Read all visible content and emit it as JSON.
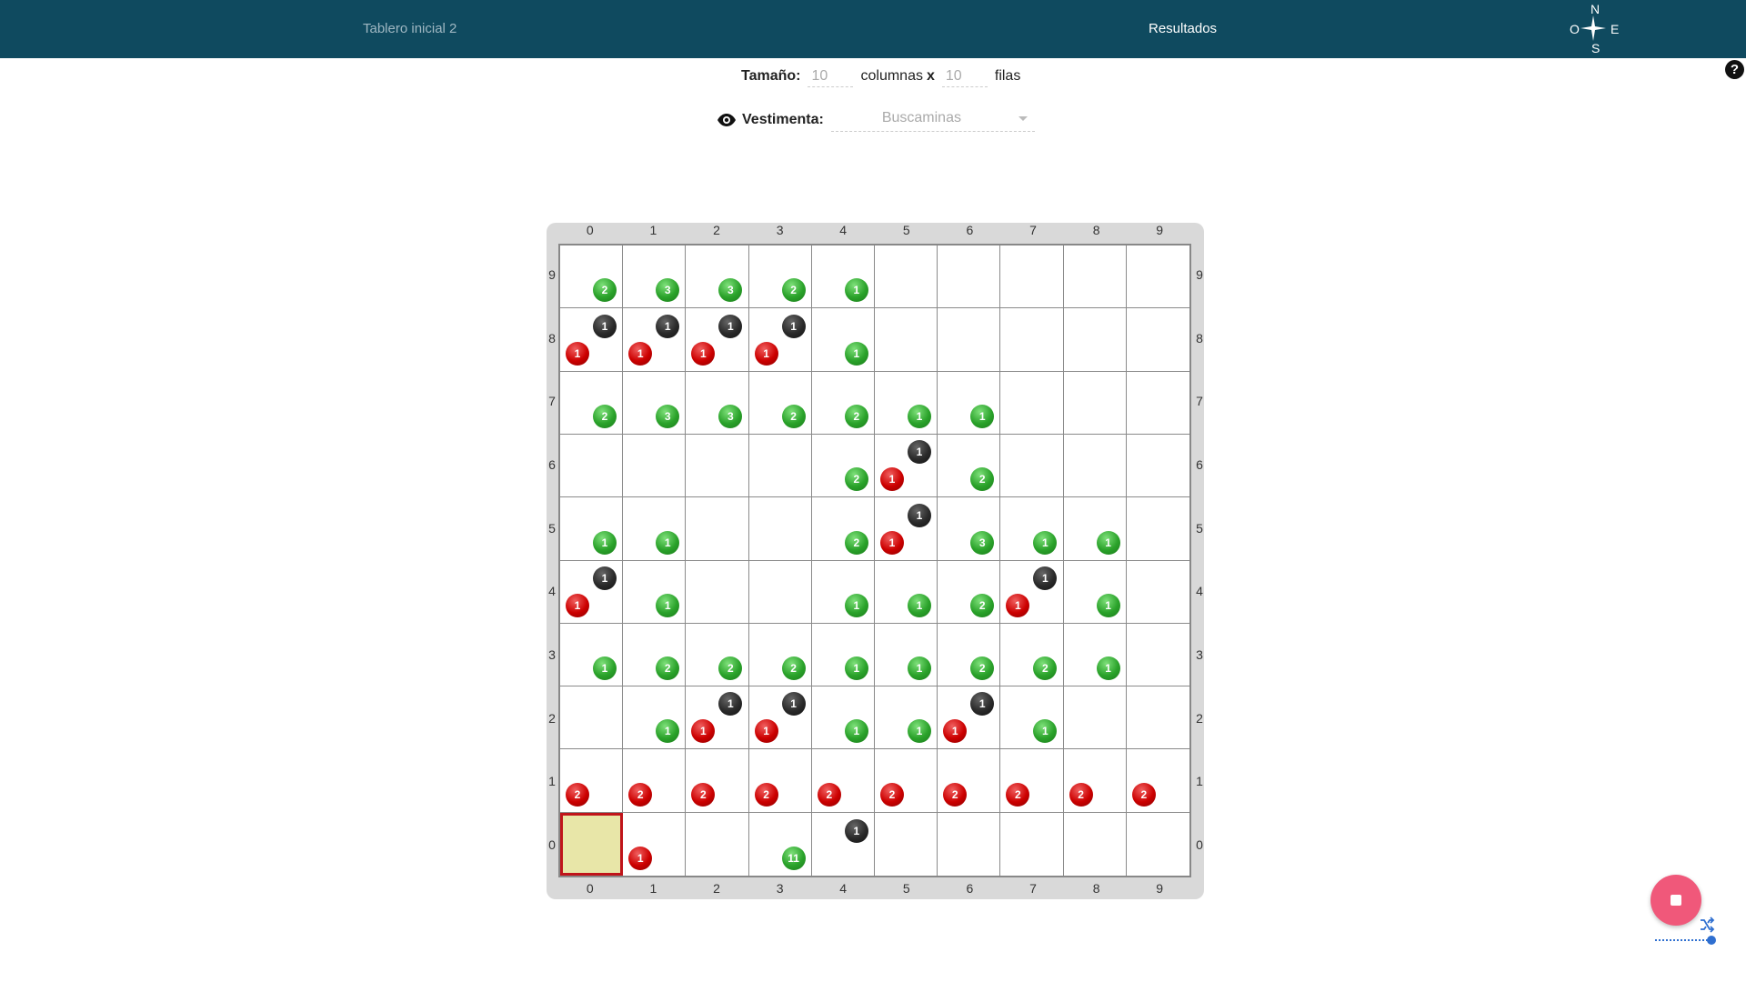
{
  "header": {
    "tab_initial": "Tablero inicial 2",
    "tab_results": "Resultados",
    "compass": {
      "n": "N",
      "s": "S",
      "o": "O",
      "e": "E"
    }
  },
  "help": {
    "label": "?"
  },
  "size": {
    "label": "Tamaño:",
    "columns_value": "10",
    "columns_label": "columnas",
    "x": "x",
    "rows_value": "10",
    "rows_label": "filas"
  },
  "vestimenta": {
    "icon": "eye-icon",
    "label": "Vestimenta:",
    "value": "Buscaminas"
  },
  "board": {
    "columns": 10,
    "rows": 10,
    "selected_cell": [
      0,
      0
    ],
    "col_labels": [
      "0",
      "1",
      "2",
      "3",
      "4",
      "5",
      "6",
      "7",
      "8",
      "9"
    ],
    "row_labels": [
      "0",
      "1",
      "2",
      "3",
      "4",
      "5",
      "6",
      "7",
      "8",
      "9"
    ],
    "colors": {
      "green": "#2aa22a",
      "red": "#cc0000",
      "black": "#222222",
      "selected": "#e8e6a8",
      "selected_border": "#c0141a"
    },
    "cells": [
      {
        "x": 0,
        "y": 9,
        "green": "2"
      },
      {
        "x": 1,
        "y": 9,
        "green": "3"
      },
      {
        "x": 2,
        "y": 9,
        "green": "3"
      },
      {
        "x": 3,
        "y": 9,
        "green": "2"
      },
      {
        "x": 4,
        "y": 9,
        "green": "1"
      },
      {
        "x": 0,
        "y": 8,
        "black": "1",
        "red": "1"
      },
      {
        "x": 1,
        "y": 8,
        "black": "1",
        "red": "1"
      },
      {
        "x": 2,
        "y": 8,
        "black": "1",
        "red": "1"
      },
      {
        "x": 3,
        "y": 8,
        "black": "1",
        "red": "1"
      },
      {
        "x": 4,
        "y": 8,
        "green": "1"
      },
      {
        "x": 0,
        "y": 7,
        "green": "2"
      },
      {
        "x": 1,
        "y": 7,
        "green": "3"
      },
      {
        "x": 2,
        "y": 7,
        "green": "3"
      },
      {
        "x": 3,
        "y": 7,
        "green": "2"
      },
      {
        "x": 4,
        "y": 7,
        "green": "2"
      },
      {
        "x": 5,
        "y": 7,
        "green": "1"
      },
      {
        "x": 6,
        "y": 7,
        "green": "1"
      },
      {
        "x": 4,
        "y": 6,
        "green": "2"
      },
      {
        "x": 5,
        "y": 6,
        "black": "1",
        "red": "1"
      },
      {
        "x": 6,
        "y": 6,
        "green": "2"
      },
      {
        "x": 0,
        "y": 5,
        "green": "1"
      },
      {
        "x": 1,
        "y": 5,
        "green": "1"
      },
      {
        "x": 4,
        "y": 5,
        "green": "2"
      },
      {
        "x": 5,
        "y": 5,
        "black": "1",
        "red": "1"
      },
      {
        "x": 6,
        "y": 5,
        "green": "3"
      },
      {
        "x": 7,
        "y": 5,
        "green": "1"
      },
      {
        "x": 8,
        "y": 5,
        "green": "1"
      },
      {
        "x": 0,
        "y": 4,
        "black": "1",
        "red": "1"
      },
      {
        "x": 1,
        "y": 4,
        "green": "1"
      },
      {
        "x": 4,
        "y": 4,
        "green": "1"
      },
      {
        "x": 5,
        "y": 4,
        "green": "1"
      },
      {
        "x": 6,
        "y": 4,
        "green": "2"
      },
      {
        "x": 7,
        "y": 4,
        "black": "1",
        "red": "1"
      },
      {
        "x": 8,
        "y": 4,
        "green": "1"
      },
      {
        "x": 0,
        "y": 3,
        "green": "1"
      },
      {
        "x": 1,
        "y": 3,
        "green": "2"
      },
      {
        "x": 2,
        "y": 3,
        "green": "2"
      },
      {
        "x": 3,
        "y": 3,
        "green": "2"
      },
      {
        "x": 4,
        "y": 3,
        "green": "1"
      },
      {
        "x": 5,
        "y": 3,
        "green": "1"
      },
      {
        "x": 6,
        "y": 3,
        "green": "2"
      },
      {
        "x": 7,
        "y": 3,
        "green": "2"
      },
      {
        "x": 8,
        "y": 3,
        "green": "1"
      },
      {
        "x": 1,
        "y": 2,
        "green": "1"
      },
      {
        "x": 2,
        "y": 2,
        "black": "1",
        "red": "1"
      },
      {
        "x": 3,
        "y": 2,
        "black": "1",
        "red": "1"
      },
      {
        "x": 4,
        "y": 2,
        "green": "1"
      },
      {
        "x": 5,
        "y": 2,
        "green": "1"
      },
      {
        "x": 6,
        "y": 2,
        "black": "1",
        "red": "1"
      },
      {
        "x": 7,
        "y": 2,
        "green": "1"
      },
      {
        "x": 0,
        "y": 1,
        "red": "2"
      },
      {
        "x": 1,
        "y": 1,
        "red": "2"
      },
      {
        "x": 2,
        "y": 1,
        "red": "2"
      },
      {
        "x": 3,
        "y": 1,
        "red": "2"
      },
      {
        "x": 4,
        "y": 1,
        "red": "2"
      },
      {
        "x": 5,
        "y": 1,
        "red": "2"
      },
      {
        "x": 6,
        "y": 1,
        "red": "2"
      },
      {
        "x": 7,
        "y": 1,
        "red": "2"
      },
      {
        "x": 8,
        "y": 1,
        "red": "2"
      },
      {
        "x": 9,
        "y": 1,
        "red": "2"
      },
      {
        "x": 1,
        "y": 0,
        "red": "1"
      },
      {
        "x": 3,
        "y": 0,
        "green": "11"
      },
      {
        "x": 4,
        "y": 0,
        "black": "1"
      }
    ]
  },
  "controls": {
    "stop_icon": "stop-icon",
    "shuffle_icon": "shuffle-icon",
    "speed_slider_level": 1.0
  }
}
